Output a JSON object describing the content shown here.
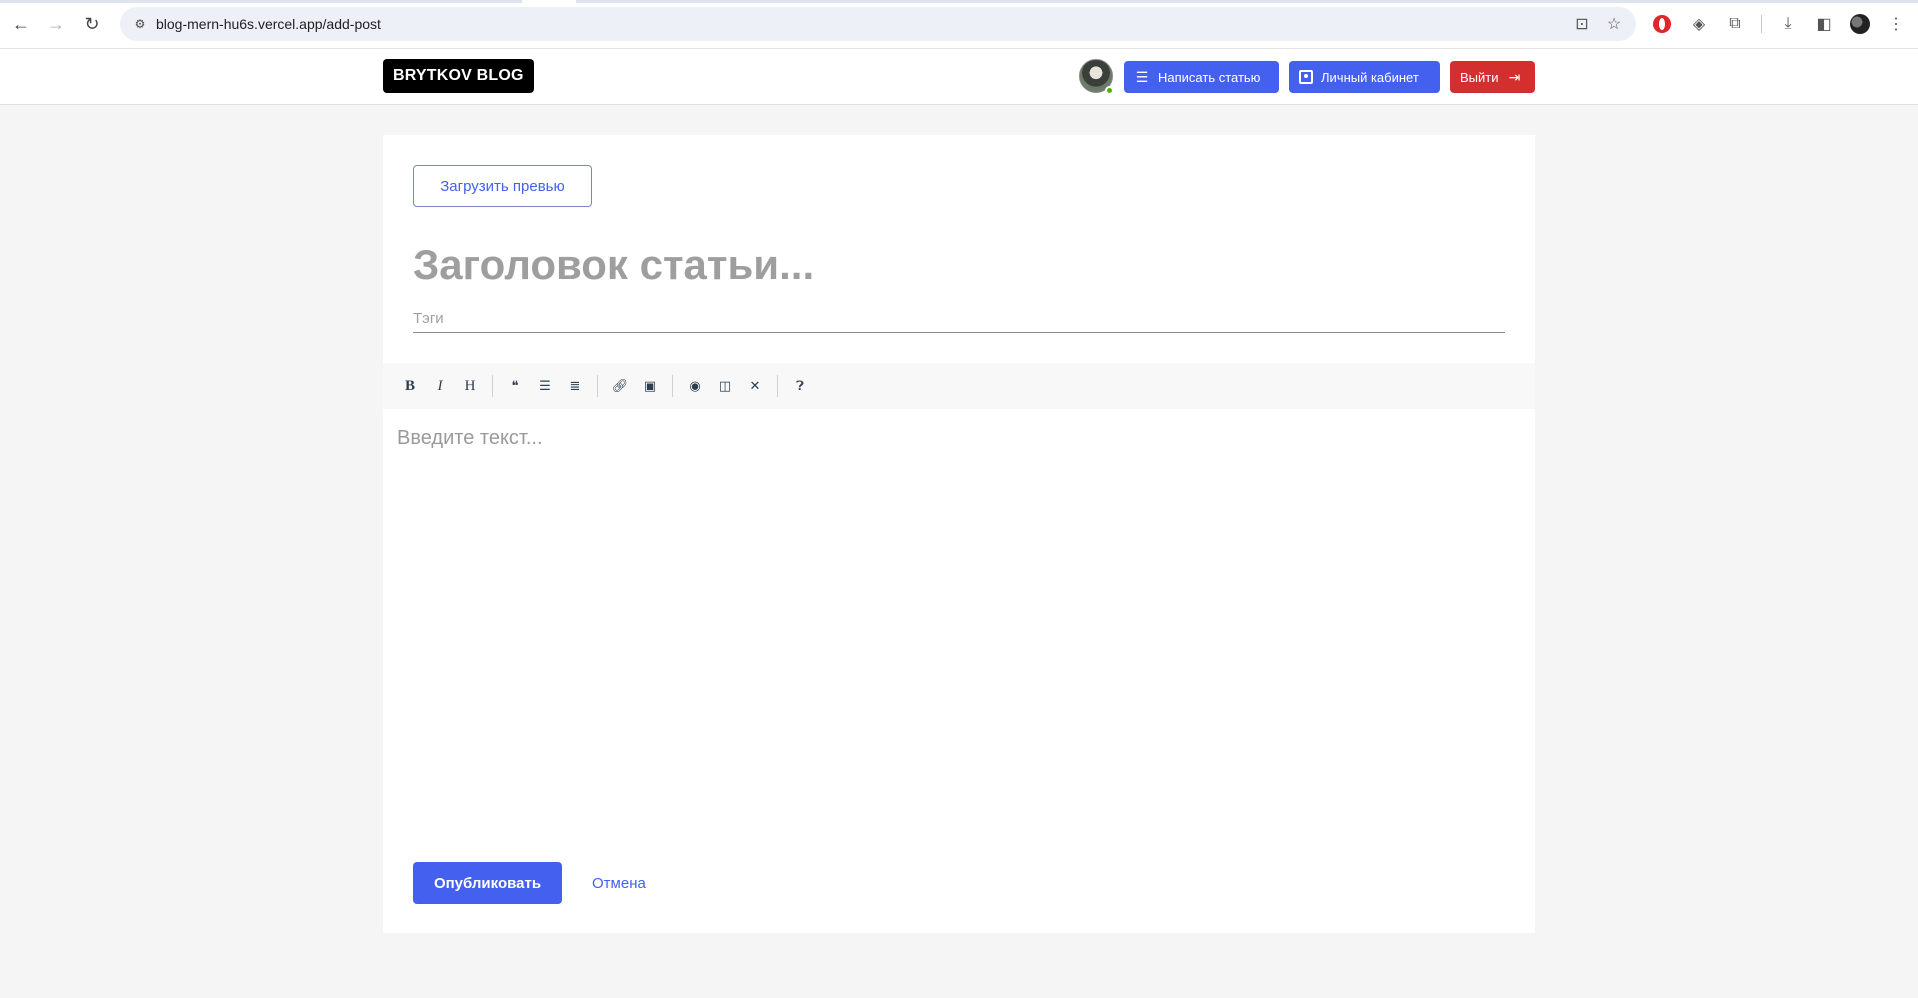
{
  "browser": {
    "url": "blog-mern-hu6s.vercel.app/add-post",
    "icons": [
      "back-arrow-icon",
      "forward-arrow-icon",
      "reload-icon",
      "site-info-icon",
      "install-app-icon",
      "bookmark-star-icon",
      "opera-extension-icon",
      "tag-extension-icon",
      "puzzle-extensions-icon",
      "download-icon",
      "side-panel-icon",
      "profile-icon",
      "kebab-menu-icon"
    ]
  },
  "header": {
    "logo": "BRYTKOV BLOG",
    "write_label": "Написать статью",
    "cabinet_label": "Личный кабинет",
    "logout_label": "Выйти"
  },
  "form": {
    "upload_label": "Загрузить превью",
    "title_placeholder": "Заголовок статьи...",
    "tags_placeholder": "Тэги",
    "body_placeholder": "Введите текст...",
    "publish_label": "Опубликовать",
    "cancel_label": "Отмена"
  },
  "toolbar": {
    "bold": "B",
    "italic": "I",
    "heading": "H"
  },
  "colors": {
    "accent": "#4361ee",
    "danger": "#d32f2f",
    "page_bg": "#f5f5f5"
  }
}
